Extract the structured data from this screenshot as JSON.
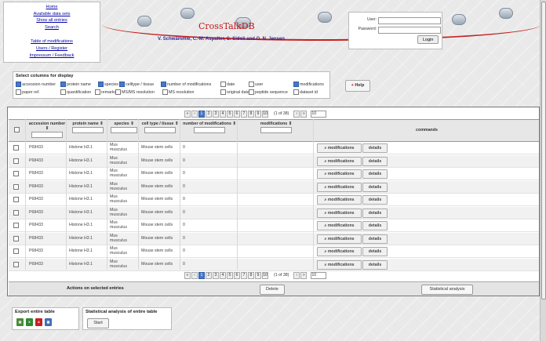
{
  "nav": {
    "links": [
      "Home",
      "Available data sets",
      "Show all entries",
      "Search",
      "Table of modifications",
      "Users / Register",
      "Impressum / Feedback"
    ]
  },
  "header": {
    "title": "CrossTalkDB",
    "authors": "V. Schwämmle, C.-M. Aspalter, S. Sidoli and O. N. Jensen"
  },
  "login": {
    "user_label": "User:",
    "password_label": "Password:",
    "button": "Login"
  },
  "columns": {
    "title": "Select columns for display",
    "options": [
      {
        "label": "accession number",
        "checked": true
      },
      {
        "label": "protein name",
        "checked": true
      },
      {
        "label": "species",
        "checked": true
      },
      {
        "label": "celltype / tissue",
        "checked": true
      },
      {
        "label": "number of modifications",
        "checked": true
      },
      {
        "label": "date",
        "checked": false
      },
      {
        "label": "user",
        "checked": false
      },
      {
        "label": "modifications",
        "checked": true
      },
      {
        "label": "paper ref.",
        "checked": false
      },
      {
        "label": "quantification",
        "checked": false
      },
      {
        "label": "remarks",
        "checked": false
      },
      {
        "label": "MS/MS resolution",
        "checked": false
      },
      {
        "label": "MS resolution",
        "checked": false
      },
      {
        "label": "original data",
        "checked": false
      },
      {
        "label": "peptide sequence",
        "checked": false
      },
      {
        "label": "dataset id",
        "checked": false
      }
    ]
  },
  "help": {
    "label": "Help",
    "icon": "plus-icon"
  },
  "pager": {
    "first": "«",
    "prev": "‹",
    "pages": [
      "1",
      "2",
      "3",
      "4",
      "5",
      "6",
      "7",
      "8",
      "9",
      "10"
    ],
    "current": "1",
    "info": "(1 of 38)",
    "next": "›",
    "last": "»",
    "per_page": "10"
  },
  "table": {
    "headers": [
      "accession number",
      "protein name",
      "species",
      "cell type / tissue",
      "number of modifications",
      "modifications",
      "commands"
    ],
    "sort_icon": "sort-icon",
    "modifications_button": "modifications",
    "details_button": "details",
    "rows": [
      {
        "accession": "P68433",
        "protein": "Histone H3.1",
        "species": "Mus musculus",
        "cell": "Mouse stem cells",
        "nmods": "0",
        "mods": ""
      },
      {
        "accession": "P68433",
        "protein": "Histone H3.1",
        "species": "Mus musculus",
        "cell": "Mouse stem cells",
        "nmods": "0",
        "mods": ""
      },
      {
        "accession": "P68433",
        "protein": "Histone H3.1",
        "species": "Mus musculus",
        "cell": "Mouse stem cells",
        "nmods": "0",
        "mods": ""
      },
      {
        "accession": "P68433",
        "protein": "Histone H3.1",
        "species": "Mus musculus",
        "cell": "Mouse stem cells",
        "nmods": "0",
        "mods": ""
      },
      {
        "accession": "P68433",
        "protein": "Histone H3.1",
        "species": "Mus musculus",
        "cell": "Mouse stem cells",
        "nmods": "0",
        "mods": ""
      },
      {
        "accession": "P68433",
        "protein": "Histone H3.1",
        "species": "Mus musculus",
        "cell": "Mouse stem cells",
        "nmods": "0",
        "mods": ""
      },
      {
        "accession": "P68433",
        "protein": "Histone H3.1",
        "species": "Mus musculus",
        "cell": "Mouse stem cells",
        "nmods": "0",
        "mods": ""
      },
      {
        "accession": "P68433",
        "protein": "Histone H3.1",
        "species": "Mus musculus",
        "cell": "Mouse stem cells",
        "nmods": "0",
        "mods": ""
      },
      {
        "accession": "P68433",
        "protein": "Histone H3.1",
        "species": "Mus musculus",
        "cell": "Mouse stem cells",
        "nmods": "0",
        "mods": ""
      },
      {
        "accession": "P68433",
        "protein": "Histone H3.1",
        "species": "Mus musculus",
        "cell": "Mouse stem cells",
        "nmods": "0",
        "mods": ""
      }
    ]
  },
  "actions": {
    "label": "Actions on selected entries",
    "delete": "Delete",
    "statistical": "Statistical analysis"
  },
  "export": {
    "title": "Export entire table",
    "icons": [
      "csv-icon",
      "xls-icon",
      "pdf-icon",
      "xml-icon"
    ]
  },
  "stats": {
    "title": "Statistical analysis of entire table",
    "start": "Start"
  },
  "colors": {
    "accent": "#4a76c4",
    "title": "#c51616",
    "authors": "#2a2a9e"
  }
}
